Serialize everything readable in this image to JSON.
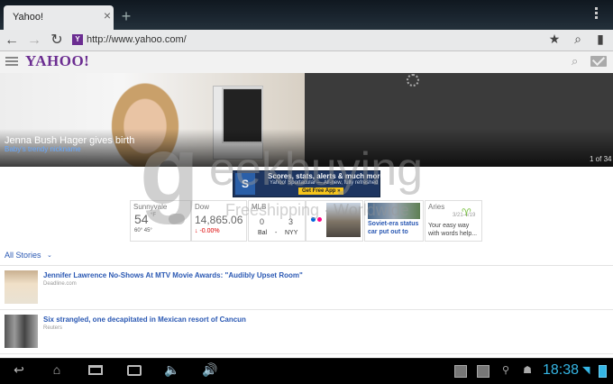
{
  "browser": {
    "tab_title": "Yahoo!",
    "tab_close": "×",
    "new_tab": "+",
    "url": "http://www.yahoo.com/",
    "favicon_letter": "Y"
  },
  "yahoo": {
    "logo": "YAHOO!"
  },
  "hero": {
    "title": "Jenna Bush Hager gives birth",
    "subtitle": "Baby's trendy nickname",
    "counter": "1 of 34"
  },
  "ad": {
    "logo": "S",
    "line1": "Scores, stats, alerts & much more!",
    "line2": "Yahoo! Sportacular — All-new, fully refreshed",
    "button": "Get Free App »"
  },
  "widgets": {
    "weather": {
      "label": "Sunnyvale",
      "temp": "54",
      "unit": "°F",
      "range": "60° 45°"
    },
    "dow": {
      "label": "Dow",
      "value": "14,865.06",
      "change": "↓ -0.00%"
    },
    "mlb": {
      "label": "MLB",
      "score1": "0",
      "score2": "3",
      "team1": "Bal",
      "dash": "-",
      "team2": "NYY"
    },
    "news": {
      "line1": "Soviet-era status",
      "line2": "car put out to"
    },
    "horoscope": {
      "label": "Aries",
      "date": "3/21-4/19",
      "icon": "♈",
      "line1": "Your easy way",
      "line2": "with words help..."
    }
  },
  "stories": {
    "label": "All Stories",
    "caret": "⌄",
    "items": [
      {
        "title": "Jennifer Lawrence No-Shows At MTV Movie Awards: \"Audibly Upset Room\"",
        "source": "Deadline.com"
      },
      {
        "title": "Six strangled, one decapitated in Mexican resort of Cancun",
        "source": "Reuters"
      }
    ]
  },
  "watermark": {
    "letter": "g",
    "brand": "eekbuying",
    "tagline": "Freeshipping · Worldwide"
  },
  "system": {
    "clock": "18:38"
  },
  "colors": {
    "yahoo_purple": "#6b2d91",
    "link_blue": "#2a58b3",
    "clock_blue": "#35b6e5"
  }
}
